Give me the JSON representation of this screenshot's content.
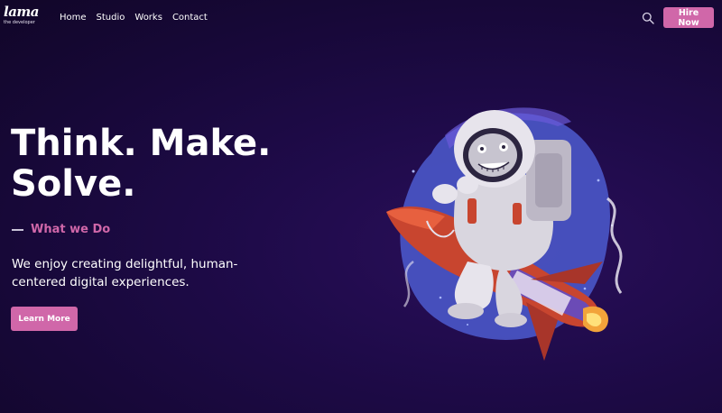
{
  "brand": {
    "logo_text": "lama",
    "logo_subtitle": "the developer"
  },
  "nav": {
    "items": [
      {
        "label": "Home"
      },
      {
        "label": "Studio"
      },
      {
        "label": "Works"
      },
      {
        "label": "Contact"
      }
    ],
    "search_icon": "search-icon",
    "hire_label": "Hire Now"
  },
  "hero": {
    "title_line1": "Think. Make.",
    "title_line2": "Solve.",
    "subheading": "What we Do",
    "description": "We enjoy creating delightful, human-centered digital experiences.",
    "cta_label": "Learn More"
  },
  "colors": {
    "accent": "#d067a9",
    "background": "#1a0a40"
  },
  "illustration": {
    "icon": "astronaut-riding-rocket"
  }
}
